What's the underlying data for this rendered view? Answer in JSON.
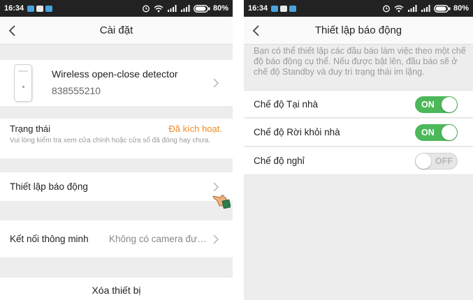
{
  "status_bar": {
    "time": "16:34",
    "battery": "80%"
  },
  "left_screen": {
    "title": "Cài đặt",
    "device": {
      "name": "Wireless open-close detector",
      "id": "838555210"
    },
    "status": {
      "label": "Trạng thái",
      "value": "Đã kích hoạt.",
      "hint": "Vui lòng kiểm tra xem cửa chính hoặc cửa sổ đã đóng hay chưa."
    },
    "alarm_setting": {
      "label": "Thiết lập báo động"
    },
    "smart_connect": {
      "label": "Kết nối thông minh",
      "value": "Không có camera được liên kết"
    },
    "delete": {
      "label": "Xóa thiết bị"
    }
  },
  "right_screen": {
    "title": "Thiết lập báo động",
    "description": "Bạn có thể thiết lập các đầu báo làm việc theo một chế độ báo động cụ thể. Nếu được bật lên, đầu báo sẽ ở chế độ Standby và duy trì trạng thái im lặng.",
    "modes": [
      {
        "label": "Chế độ Tại nhà",
        "toggle": "ON",
        "on": true
      },
      {
        "label": "Chế độ Rời khỏi nhà",
        "toggle": "ON",
        "on": true
      },
      {
        "label": "Chế độ nghỉ",
        "toggle": "OFF",
        "on": false
      }
    ]
  },
  "colors": {
    "accent_orange": "#f08a24",
    "toggle_on": "#4cb85a",
    "statusbar": "#222222",
    "background": "#ededed"
  },
  "icons": [
    "back-arrow-icon",
    "chevron-right-icon",
    "wifi-icon",
    "signal-icon",
    "alarm-clock-icon",
    "battery-icon",
    "pointing-hand-icon"
  ]
}
